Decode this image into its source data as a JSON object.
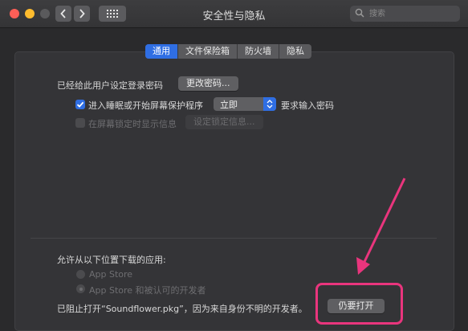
{
  "window": {
    "title": "安全性与隐私"
  },
  "search": {
    "placeholder": "搜索"
  },
  "tabs": [
    {
      "label": "通用",
      "active": true
    },
    {
      "label": "文件保险箱",
      "active": false
    },
    {
      "label": "防火墙",
      "active": false
    },
    {
      "label": "隐私",
      "active": false
    }
  ],
  "general": {
    "password_set_text": "已经给此用户设定登录密码",
    "change_password_button": "更改密码...",
    "require_password": {
      "checked": true,
      "prefix": "进入睡眠或开始屏幕保护程序",
      "select_value": "立即",
      "suffix": "要求输入密码"
    },
    "lock_message": {
      "checked": false,
      "label": "在屏幕锁定时显示信息",
      "button": "设定锁定信息..."
    }
  },
  "downloads": {
    "heading": "允许从以下位置下载的应用:",
    "options": [
      {
        "label": "App Store",
        "selected": false
      },
      {
        "label": "App Store 和被认可的开发者",
        "selected": true
      }
    ],
    "blocked_text": "已阻止打开“Soundflower.pkg”，因为来自身份不明的开发者。",
    "open_anyway_button": "仍要打开"
  },
  "annotation_color": "#e9357d",
  "accent_color": "#2f6ee3"
}
